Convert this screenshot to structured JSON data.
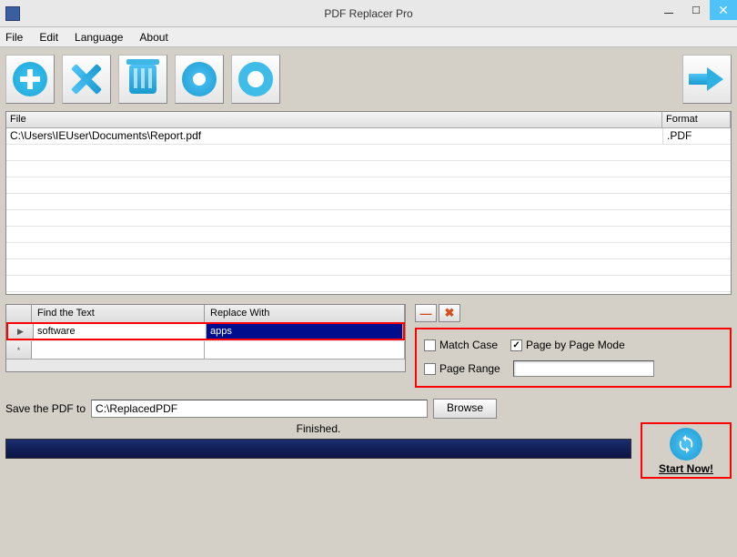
{
  "window": {
    "title": "PDF Replacer Pro"
  },
  "menu": {
    "file": "File",
    "edit": "Edit",
    "language": "Language",
    "about": "About"
  },
  "toolbar": {
    "add": "add",
    "remove": "remove",
    "clear": "clear",
    "settings": "settings",
    "help": "help",
    "run": "run"
  },
  "fileTable": {
    "headers": {
      "file": "File",
      "format": "Format"
    },
    "rows": [
      {
        "file": "C:\\Users\\IEUser\\Documents\\Report.pdf",
        "format": ".PDF"
      }
    ]
  },
  "replaceGrid": {
    "headers": {
      "find": "Find the Text",
      "replace": "Replace With"
    },
    "rows": [
      {
        "find": "software",
        "replace": "apps"
      }
    ]
  },
  "options": {
    "matchCase": {
      "label": "Match Case",
      "checked": false
    },
    "pageByPage": {
      "label": "Page by Page Mode",
      "checked": true
    },
    "pageRange": {
      "label": "Page Range",
      "checked": false,
      "value": ""
    }
  },
  "save": {
    "label": "Save the PDF to",
    "path": "C:\\ReplacedPDF",
    "browse": "Browse"
  },
  "progress": {
    "status": "Finished."
  },
  "start": {
    "label": "Start Now!"
  }
}
